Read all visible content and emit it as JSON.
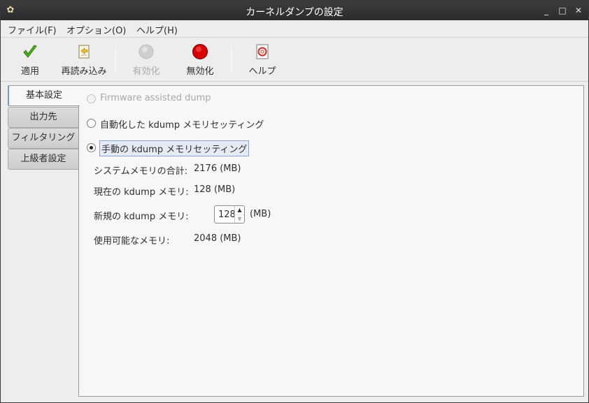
{
  "window": {
    "title": "カーネルダンプの設定"
  },
  "menubar": {
    "file": "ファイル(F)",
    "options": "オプション(O)",
    "help": "ヘルプ(H)"
  },
  "toolbar": {
    "apply": "適用",
    "reload": "再読み込み",
    "enable": "有効化",
    "disable": "無効化",
    "help": "ヘルプ"
  },
  "tabs": [
    "基本設定",
    "出力先",
    "フィルタリング",
    "上級者設定"
  ],
  "basic": {
    "firmware_assisted": "Firmware assisted dump",
    "auto_setting": "自動化した kdump メモリセッティング",
    "manual_setting": "手動の kdump メモリセッティング",
    "total_memory_label": "システムメモリの合計:",
    "total_memory_value": "2176 (MB)",
    "current_label": "現在の kdump メモリ:",
    "current_value": "128 (MB)",
    "new_label": "新規の kdump メモリ:",
    "new_value": "128",
    "new_unit": "(MB)",
    "usable_label": "使用可能なメモリ:",
    "usable_value": "2048 (MB)"
  },
  "colors": {
    "apply_check": "#4caf1e",
    "disable_red": "#d80000",
    "enable_gray": "#c8c8c8",
    "accent": "#6f9ad6"
  },
  "icons": {
    "apply": "checkmark-icon",
    "reload": "reload-icon",
    "enable": "enable-circle-icon",
    "disable": "disable-circle-icon",
    "help": "help-lifebuoy-icon"
  }
}
